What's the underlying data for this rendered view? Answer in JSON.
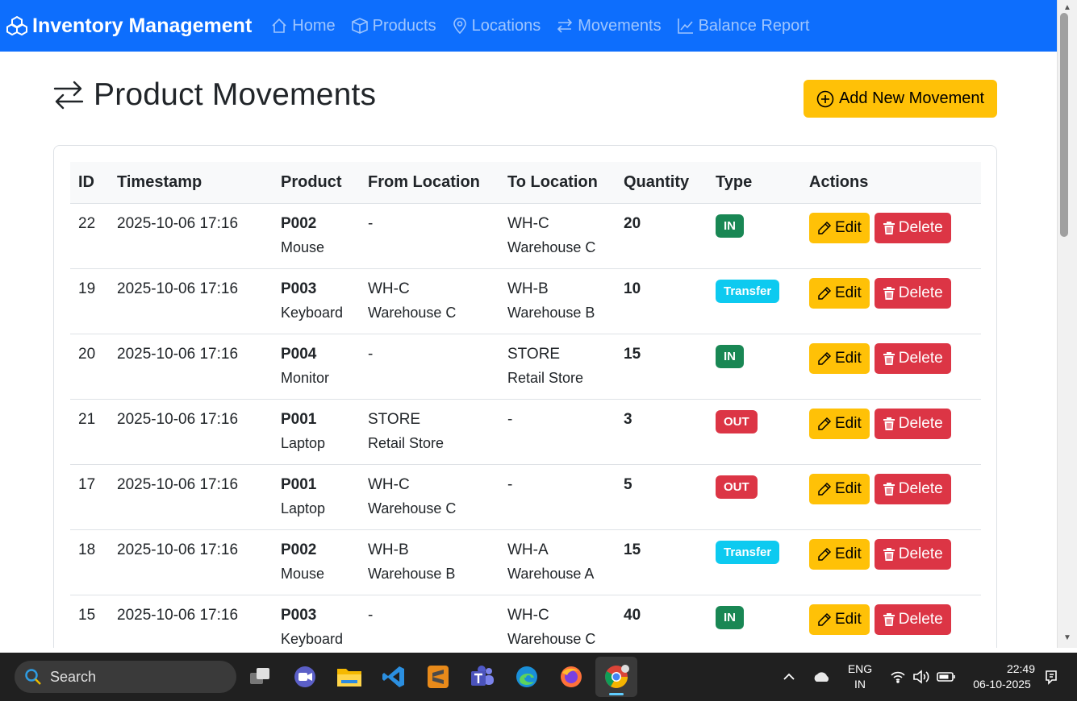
{
  "navbar": {
    "brand": "Inventory Management",
    "links": [
      {
        "label": "Home",
        "icon": "house-icon"
      },
      {
        "label": "Products",
        "icon": "box-icon"
      },
      {
        "label": "Locations",
        "icon": "geo-pin-icon"
      },
      {
        "label": "Movements",
        "icon": "arrows-exchange-icon"
      },
      {
        "label": "Balance Report",
        "icon": "line-chart-icon"
      }
    ]
  },
  "page": {
    "title": "Product Movements",
    "add_button": "Add New Movement"
  },
  "table": {
    "headers": [
      "ID",
      "Timestamp",
      "Product",
      "From Location",
      "To Location",
      "Quantity",
      "Type",
      "Actions"
    ],
    "rows": [
      {
        "id": "22",
        "timestamp": "2025-10-06 17:16",
        "product_code": "P002",
        "product_name": "Mouse",
        "from_code": "-",
        "from_name": "",
        "to_code": "WH-C",
        "to_name": "Warehouse C",
        "quantity": "20",
        "type": "IN"
      },
      {
        "id": "19",
        "timestamp": "2025-10-06 17:16",
        "product_code": "P003",
        "product_name": "Keyboard",
        "from_code": "WH-C",
        "from_name": "Warehouse C",
        "to_code": "WH-B",
        "to_name": "Warehouse B",
        "quantity": "10",
        "type": "Transfer"
      },
      {
        "id": "20",
        "timestamp": "2025-10-06 17:16",
        "product_code": "P004",
        "product_name": "Monitor",
        "from_code": "-",
        "from_name": "",
        "to_code": "STORE",
        "to_name": "Retail Store",
        "quantity": "15",
        "type": "IN"
      },
      {
        "id": "21",
        "timestamp": "2025-10-06 17:16",
        "product_code": "P001",
        "product_name": "Laptop",
        "from_code": "STORE",
        "from_name": "Retail Store",
        "to_code": "-",
        "to_name": "",
        "quantity": "3",
        "type": "OUT"
      },
      {
        "id": "17",
        "timestamp": "2025-10-06 17:16",
        "product_code": "P001",
        "product_name": "Laptop",
        "from_code": "WH-C",
        "from_name": "Warehouse C",
        "to_code": "-",
        "to_name": "",
        "quantity": "5",
        "type": "OUT"
      },
      {
        "id": "18",
        "timestamp": "2025-10-06 17:16",
        "product_code": "P002",
        "product_name": "Mouse",
        "from_code": "WH-B",
        "from_name": "Warehouse B",
        "to_code": "WH-A",
        "to_name": "Warehouse A",
        "quantity": "15",
        "type": "Transfer"
      },
      {
        "id": "15",
        "timestamp": "2025-10-06 17:16",
        "product_code": "P003",
        "product_name": "Keyboard",
        "from_code": "-",
        "from_name": "",
        "to_code": "WH-C",
        "to_name": "Warehouse C",
        "quantity": "40",
        "type": "IN"
      }
    ],
    "edit_label": "Edit",
    "delete_label": "Delete"
  },
  "taskbar": {
    "search_placeholder": "Search",
    "lang_top": "ENG",
    "lang_bottom": "IN",
    "time": "22:49",
    "date": "06-10-2025"
  },
  "colors": {
    "primary": "#0d6efd",
    "warning": "#ffc107",
    "danger": "#dc3545",
    "success": "#198754",
    "info": "#0dcaf0"
  }
}
